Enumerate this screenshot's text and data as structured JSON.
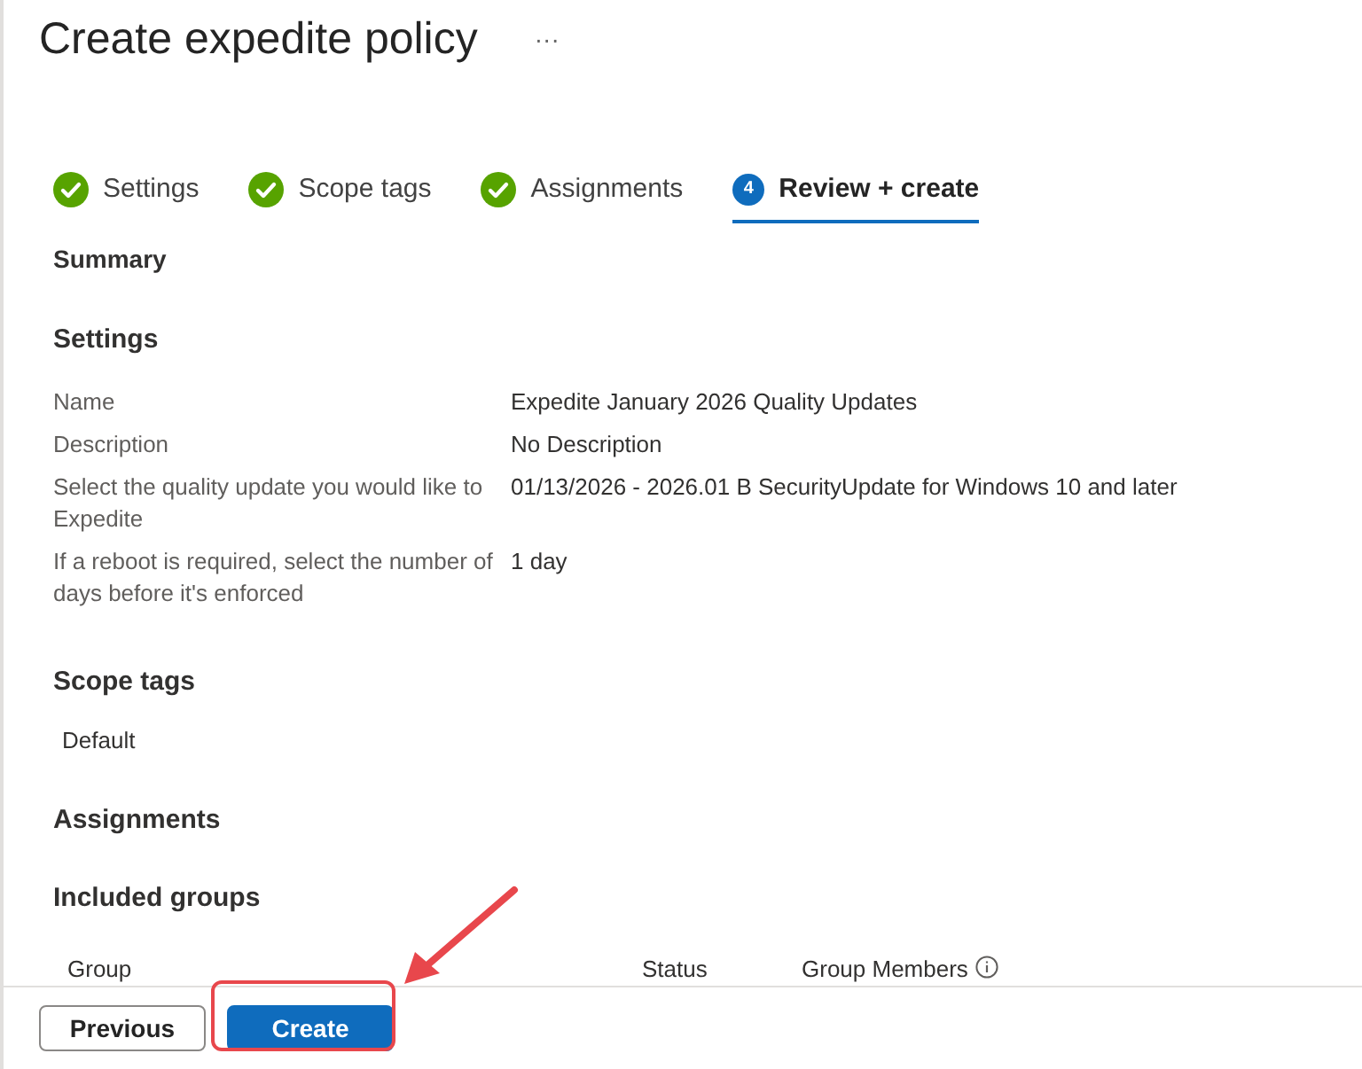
{
  "page": {
    "title": "Create expedite policy",
    "more": "···"
  },
  "steps": [
    {
      "label": "Settings",
      "kind": "done",
      "selected": false
    },
    {
      "label": "Scope tags",
      "kind": "done",
      "selected": false
    },
    {
      "label": "Assignments",
      "kind": "done",
      "selected": false
    },
    {
      "label": "Review + create",
      "kind": "number",
      "number": "4",
      "selected": true
    }
  ],
  "summary": {
    "heading": "Summary"
  },
  "settings": {
    "heading": "Settings",
    "rows": [
      {
        "label": "Name",
        "value": "Expedite January 2026 Quality Updates"
      },
      {
        "label": "Description",
        "value": "No Description"
      },
      {
        "label": "Select the quality update you would like to Expedite",
        "value": "01/13/2026 - 2026.01 B SecurityUpdate for Windows 10 and later"
      },
      {
        "label": "If a reboot is required, select the number of days before it's enforced",
        "value": "1 day"
      }
    ]
  },
  "scope_tags": {
    "heading": "Scope tags",
    "items": [
      "Default"
    ]
  },
  "assignments": {
    "heading": "Assignments",
    "subheading": "Included groups",
    "columns": [
      "Group",
      "Status",
      "Group Members"
    ]
  },
  "footer": {
    "buttons": [
      {
        "label": "Previous",
        "kind": "secondary"
      },
      {
        "label": "Create",
        "kind": "primary"
      }
    ]
  },
  "annotation": {
    "highlight": true
  }
}
